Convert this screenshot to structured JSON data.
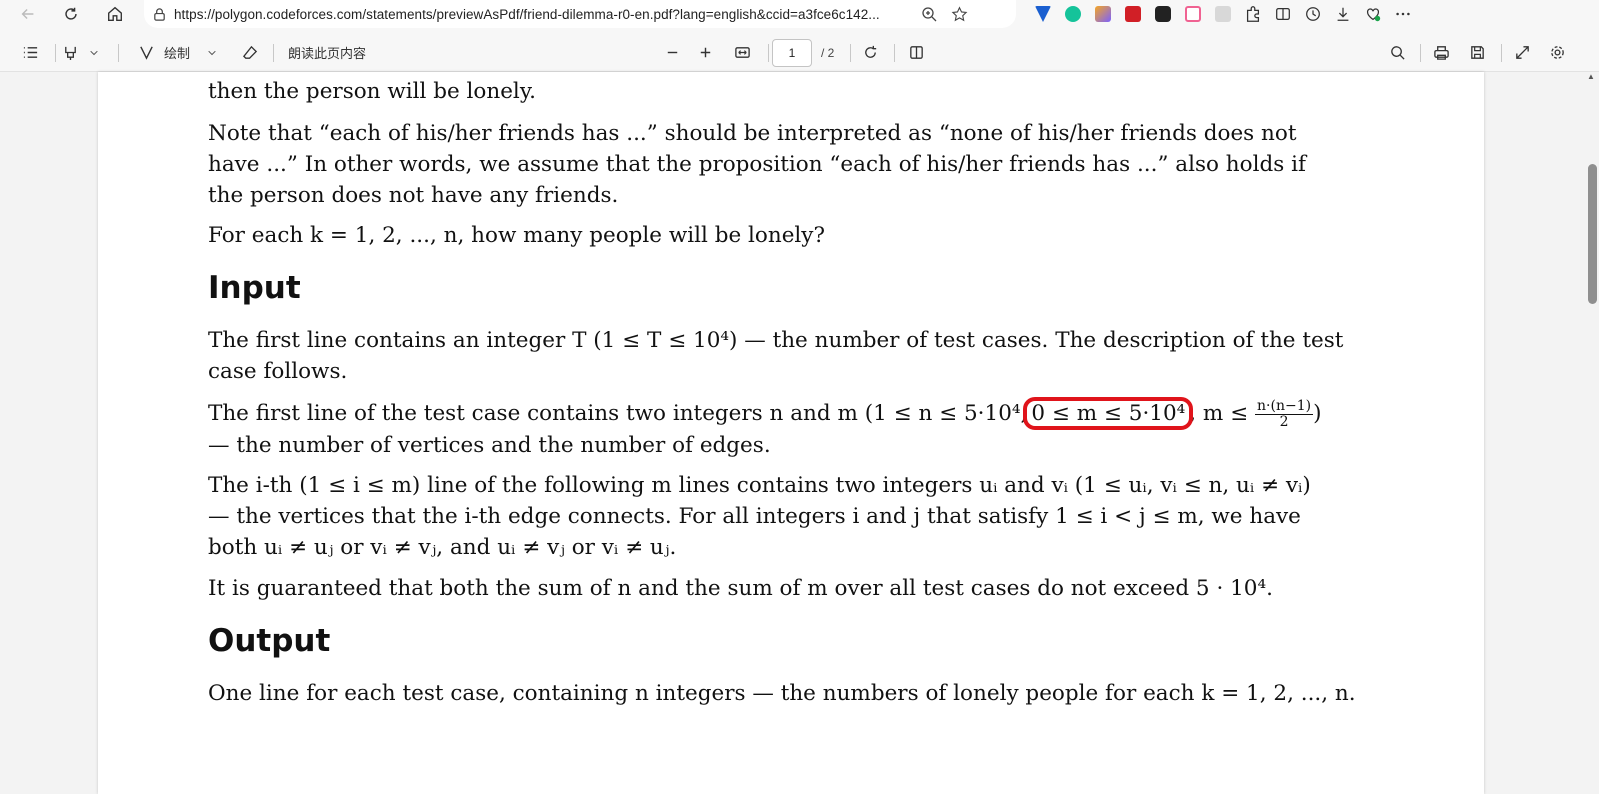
{
  "browser": {
    "url": "https://polygon.codeforces.com/statements/previewAsPdf/friend-dilemma-r0-en.pdf?lang=english&ccid=a3fce6c142..."
  },
  "pdf_toolbar": {
    "draw_label": "绘制",
    "read_aloud_label": "朗读此页内容",
    "page_current": "1",
    "page_total": "/ 2"
  },
  "doc": {
    "line_top": "then the person will be lonely.",
    "p_note_1": "Note that “each of his/her friends has ...” should be interpreted as “none of his/her friends does not",
    "p_note_2": "have ...” In other words, we assume that the proposition “each of his/her friends has ...” also holds if",
    "p_note_3": "the person does not have any friends.",
    "p_foreach": "For each k = 1, 2, ..., n, how many people will be lonely?",
    "h_input": "Input",
    "p_t_1": "The first line contains an integer T (1 ≤ T ≤ 10⁴) — the number of test cases. The description of the test",
    "p_t_2": "case follows.",
    "p_nm_1a": "The first line of the test case contains two integers n and m (1 ≤ n ≤ 5·10⁴,",
    "p_nm_1b": "0 ≤ m ≤ 5·10⁴",
    "p_nm_1c": ", m ≤",
    "p_nm_frac_num": "n·(n−1)",
    "p_nm_frac_den": "2",
    "p_nm_1d": ")",
    "p_nm_2": "— the number of vertices and the number of edges.",
    "p_edge_1": "The i-th (1 ≤ i ≤ m) line of the following m lines contains two integers uᵢ and vᵢ (1 ≤ uᵢ, vᵢ ≤ n, uᵢ ≠ vᵢ)",
    "p_edge_2": "— the vertices that the i-th edge connects. For all integers i and j that satisfy 1 ≤ i < j ≤ m, we have",
    "p_edge_3": "both uᵢ ≠ uⱼ or vᵢ ≠ vⱼ, and uᵢ ≠ vⱼ or vᵢ ≠ uⱼ.",
    "p_sum": "It is guaranteed that both the sum of n and the sum of m over all test cases do not exceed 5 · 10⁴.",
    "h_output": "Output",
    "p_out": "One line for each test case, containing n integers — the numbers of lonely people for each k = 1, 2, ..., n."
  },
  "colors": {
    "highlight": "#e0141b"
  }
}
